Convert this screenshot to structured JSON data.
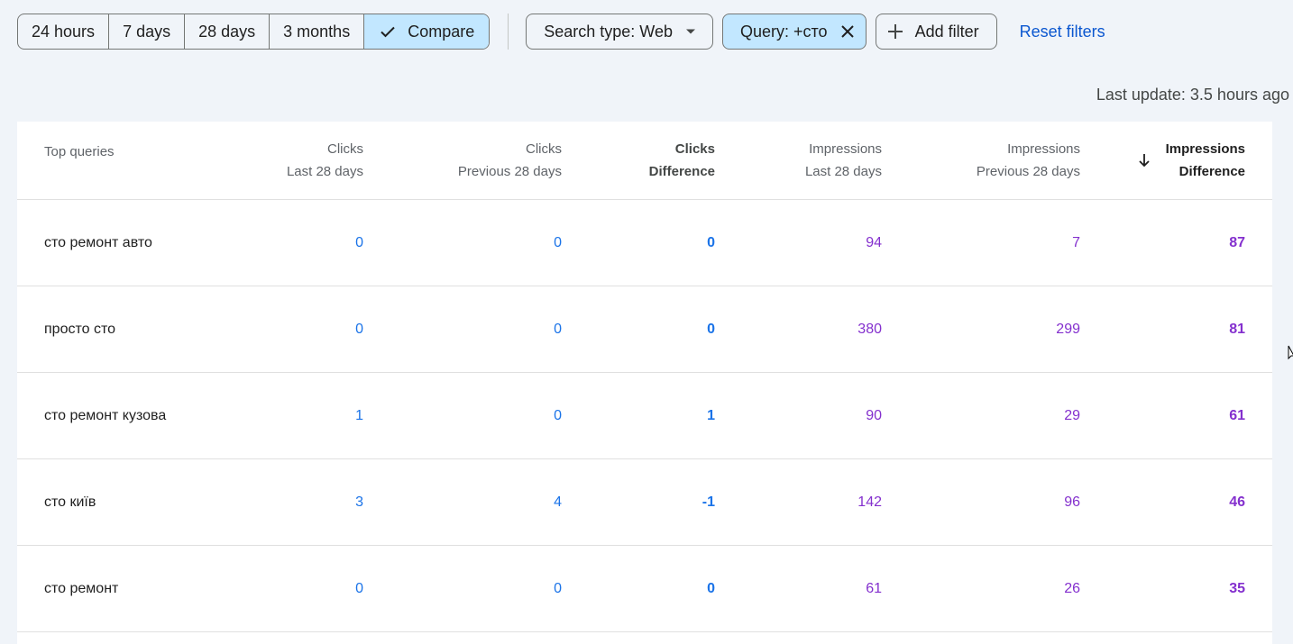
{
  "filters": {
    "date_ranges": [
      {
        "label": "24 hours",
        "active": false
      },
      {
        "label": "7 days",
        "active": false
      },
      {
        "label": "28 days",
        "active": false
      },
      {
        "label": "3 months",
        "active": false
      },
      {
        "label": "Compare",
        "active": true
      }
    ],
    "search_type_label": "Search type: Web",
    "query_filter_label": "Query: +сто",
    "add_filter_label": "Add filter",
    "reset_label": "Reset filters"
  },
  "last_update": "Last update: 3.5 hours ago",
  "table": {
    "headers": [
      {
        "line1": "Top queries",
        "line2": ""
      },
      {
        "line1": "Clicks",
        "line2": "Last 28 days"
      },
      {
        "line1": "Clicks",
        "line2": "Previous 28 days"
      },
      {
        "line1": "Clicks",
        "line2": "Difference"
      },
      {
        "line1": "Impressions",
        "line2": "Last 28 days"
      },
      {
        "line1": "Impressions",
        "line2": "Previous 28 days"
      },
      {
        "line1": "Impressions",
        "line2": "Difference"
      }
    ],
    "sorted_column": "Impressions Difference",
    "sort_direction": "descending",
    "rows": [
      {
        "query": "сто ремонт авто",
        "clicks_last": "0",
        "clicks_prev": "0",
        "clicks_diff": "0",
        "impr_last": "94",
        "impr_prev": "7",
        "impr_diff": "87"
      },
      {
        "query": "просто сто",
        "clicks_last": "0",
        "clicks_prev": "0",
        "clicks_diff": "0",
        "impr_last": "380",
        "impr_prev": "299",
        "impr_diff": "81"
      },
      {
        "query": "сто ремонт кузова",
        "clicks_last": "1",
        "clicks_prev": "0",
        "clicks_diff": "1",
        "impr_last": "90",
        "impr_prev": "29",
        "impr_diff": "61"
      },
      {
        "query": "сто київ",
        "clicks_last": "3",
        "clicks_prev": "4",
        "clicks_diff": "-1",
        "impr_last": "142",
        "impr_prev": "96",
        "impr_diff": "46"
      },
      {
        "query": "сто ремонт",
        "clicks_last": "0",
        "clicks_prev": "0",
        "clicks_diff": "0",
        "impr_last": "61",
        "impr_prev": "26",
        "impr_diff": "35"
      }
    ]
  },
  "colors": {
    "clicks": "#1a73e8",
    "impressions": "#8430ce",
    "active_chip": "#c2e7ff",
    "link": "#0b57d0",
    "background": "#f0f4f9"
  },
  "icons": [
    "check-icon",
    "caret-down-icon",
    "close-icon",
    "plus-icon",
    "arrow-down-icon"
  ]
}
